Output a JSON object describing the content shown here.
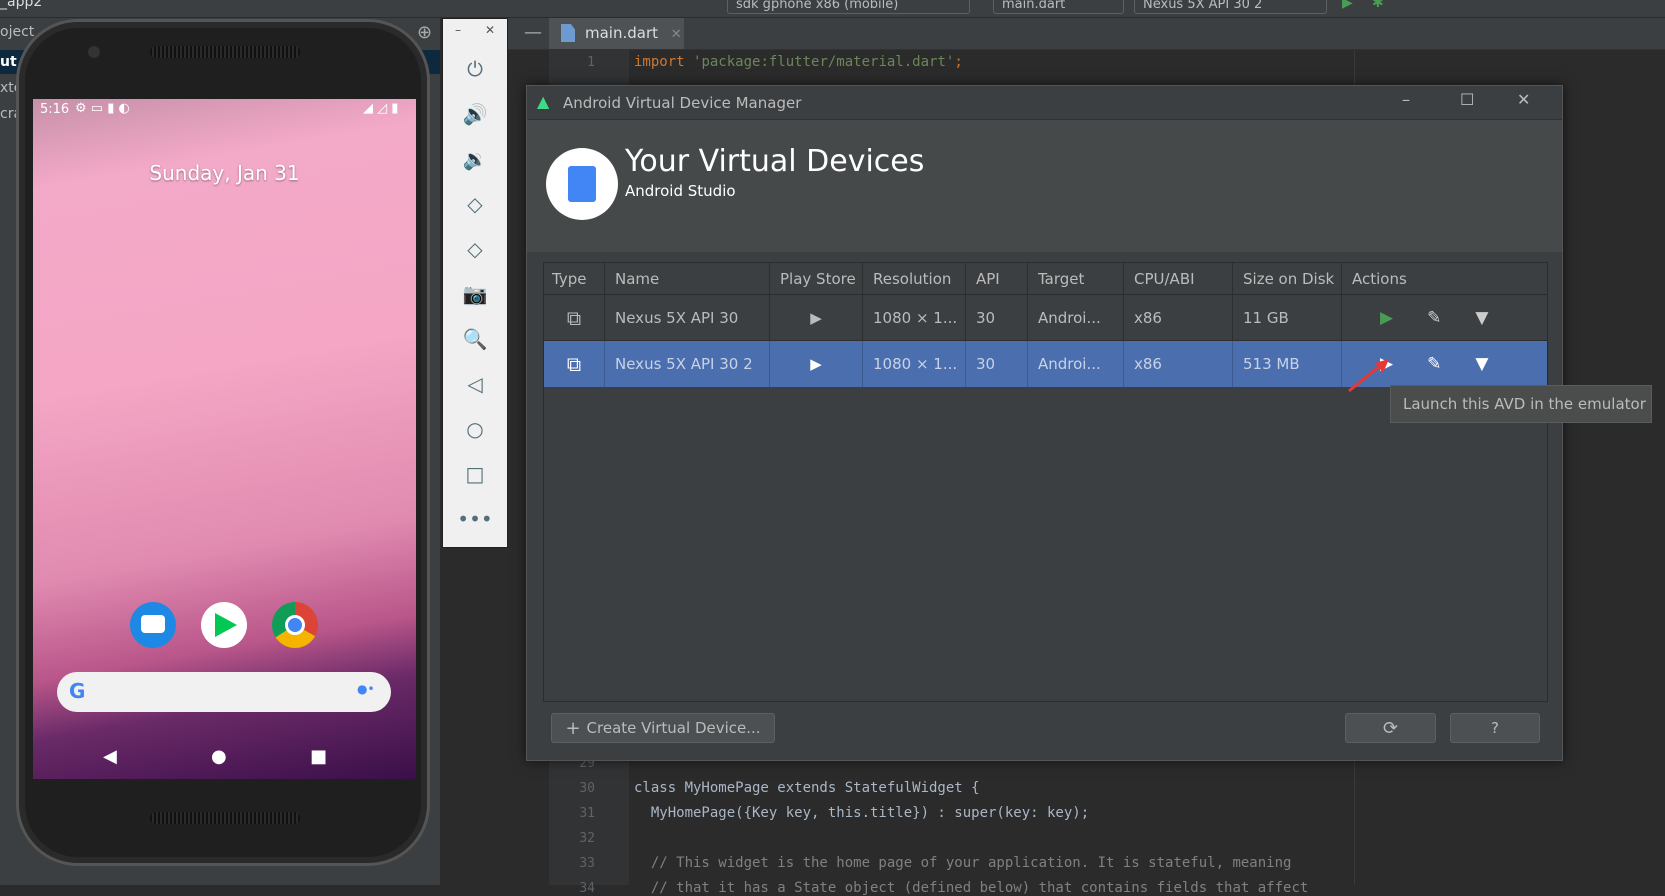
{
  "ide": {
    "project_title": "_app2",
    "run_config": "sdk gphone x86 (mobile)",
    "file_config": "main.dart",
    "device_config": "Nexus 5X API 30 2",
    "left_panel": [
      "oject",
      "ut",
      "xte",
      "cra"
    ],
    "tab": "main.dart",
    "code_top": {
      "line": "1",
      "text": "import 'package:flutter/material.dart';"
    },
    "code_bottom": [
      {
        "line": "29",
        "text": ""
      },
      {
        "line": "30",
        "text": "class MyHomePage extends StatefulWidget {"
      },
      {
        "line": "31",
        "text": "  MyHomePage({Key key, this.title}) : super(key: key);"
      },
      {
        "line": "32",
        "text": ""
      },
      {
        "line": "33",
        "text": "  // This widget is the home page of your application. It is stateful, meaning"
      },
      {
        "line": "34",
        "text": "  // that it has a State object (defined below) that contains fields that affect"
      }
    ]
  },
  "phone": {
    "time": "5:16",
    "date": "Sunday, Jan 31",
    "apps": [
      "messages-icon",
      "play-store-icon",
      "chrome-icon"
    ]
  },
  "avd": {
    "window_title": "Android Virtual Device Manager",
    "heading": "Your Virtual Devices",
    "subheading": "Android Studio",
    "columns": [
      "Type",
      "Name",
      "Play Store",
      "Resolution",
      "API",
      "Target",
      "CPU/ABI",
      "Size on Disk",
      "Actions"
    ],
    "rows": [
      {
        "name": "Nexus 5X API 30",
        "resolution": "1080 × 1...",
        "api": "30",
        "target": "Androi...",
        "cpu": "x86",
        "size": "11 GB",
        "selected": false
      },
      {
        "name": "Nexus 5X API 30 2",
        "resolution": "1080 × 1...",
        "api": "30",
        "target": "Androi...",
        "cpu": "x86",
        "size": "513 MB",
        "selected": true
      }
    ],
    "tooltip": "Launch this AVD in the emulator",
    "create_label": "Create Virtual Device...",
    "help_label": "?",
    "colors": {
      "selection": "#4b6eaf",
      "run_green": "#499c54",
      "annotation_arrow": "#e53935"
    }
  }
}
